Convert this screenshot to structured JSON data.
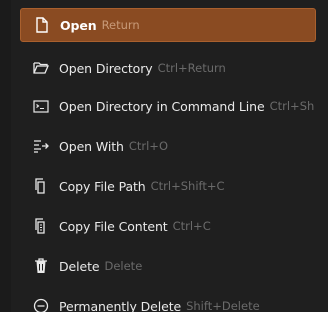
{
  "menu": {
    "items": [
      {
        "label": "Open",
        "shortcut": "Return",
        "icon": "file-icon",
        "selected": true
      },
      {
        "label": "Open Directory",
        "shortcut": "Ctrl+Return",
        "icon": "folder-open-icon"
      },
      {
        "label": "Open Directory in Command Line",
        "shortcut": "Ctrl+Sh",
        "icon": "terminal-icon"
      },
      {
        "label": "Open With",
        "shortcut": "Ctrl+O",
        "icon": "list-arrow-icon"
      },
      {
        "label": "Copy File Path",
        "shortcut": "Ctrl+Shift+C",
        "icon": "copy-icon"
      },
      {
        "label": "Copy File Content",
        "shortcut": "Ctrl+C",
        "icon": "copy-content-icon"
      },
      {
        "label": "Delete",
        "shortcut": "Delete",
        "icon": "trash-icon"
      },
      {
        "label": "Permanently Delete",
        "shortcut": "Shift+Delete",
        "icon": "permanent-delete-icon"
      }
    ]
  },
  "colors": {
    "background": "#1f1f1f",
    "selected_background": "#8a4b22",
    "text": "#e9e9e9",
    "shortcut_text": "#6a6a6a"
  }
}
